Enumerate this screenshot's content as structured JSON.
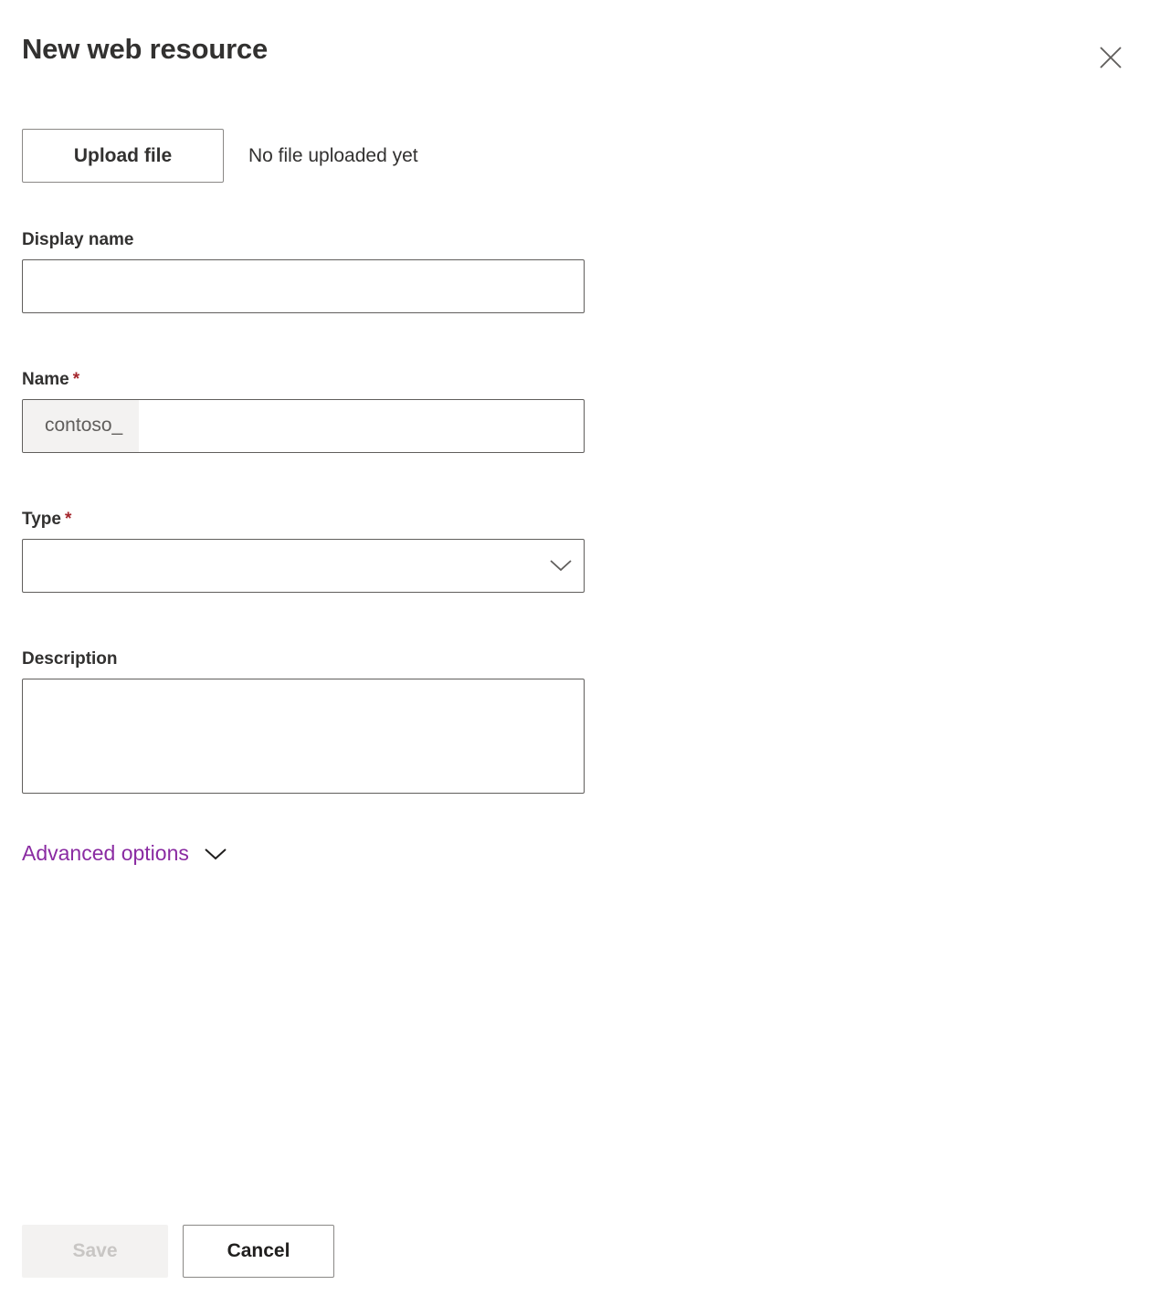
{
  "header": {
    "title": "New web resource",
    "close_icon": "close-icon"
  },
  "upload": {
    "button_label": "Upload file",
    "status_text": "No file uploaded yet"
  },
  "fields": {
    "display_name": {
      "label": "Display name",
      "value": "",
      "placeholder": ""
    },
    "name": {
      "label": "Name",
      "required_marker": "*",
      "prefix": "contoso_",
      "value": "",
      "placeholder": ""
    },
    "type": {
      "label": "Type",
      "required_marker": "*",
      "value": "",
      "chevron_icon": "chevron-down-icon"
    },
    "description": {
      "label": "Description",
      "value": "",
      "placeholder": ""
    }
  },
  "advanced": {
    "label": "Advanced options",
    "chevron_icon": "chevron-down-icon"
  },
  "footer": {
    "save_label": "Save",
    "cancel_label": "Cancel"
  },
  "colors": {
    "accent_link": "#8A2BA2",
    "required_asterisk": "#A4262C",
    "text_primary": "#323130",
    "border": "#605E5C",
    "disabled_bg": "#F3F2F1"
  }
}
